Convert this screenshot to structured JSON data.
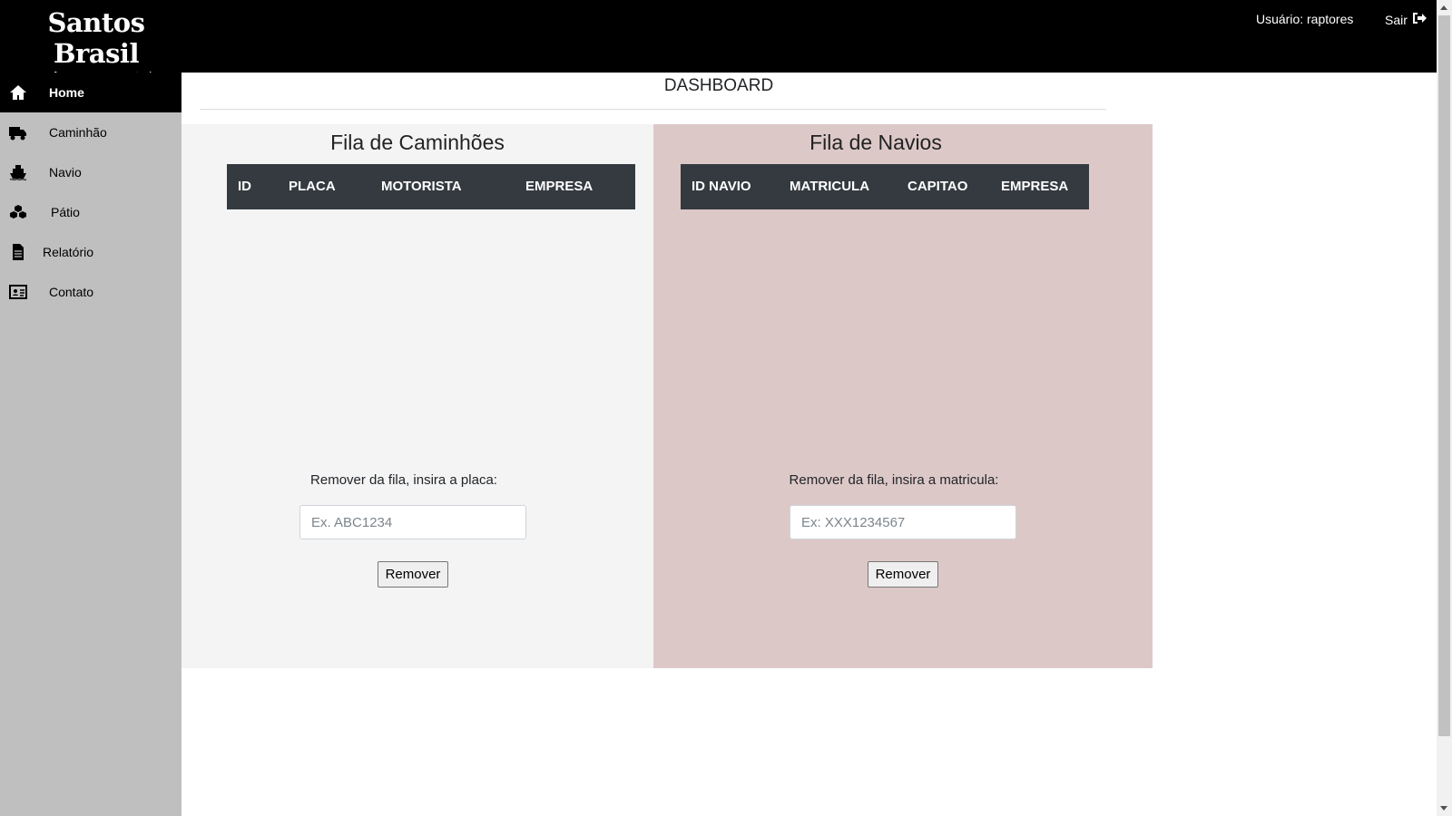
{
  "header": {
    "logo_title": "Santos Brasil",
    "logo_subtitle": "você sempre conectado",
    "user_label": "Usuário: raptores",
    "logout_label": "Sair",
    "logout_icon": "sign-out-icon"
  },
  "sidebar": {
    "items": [
      {
        "label": "Home",
        "icon": "home-icon",
        "active": true
      },
      {
        "label": "Caminhão",
        "icon": "truck-icon",
        "active": false
      },
      {
        "label": "Navio",
        "icon": "ship-icon",
        "active": false
      },
      {
        "label": "Pátio",
        "icon": "cubes-icon",
        "active": false
      },
      {
        "label": "Relatório",
        "icon": "file-icon",
        "active": false
      },
      {
        "label": "Contato",
        "icon": "id-card-icon",
        "active": false
      }
    ]
  },
  "main": {
    "title": "DASHBOARD",
    "trucks": {
      "title": "Fila de Caminhões",
      "columns": [
        "ID",
        "PLACA",
        "MOTORISTA",
        "EMPRESA"
      ],
      "rows": [],
      "remove_label": "Remover da fila, insira a placa:",
      "placeholder": "Ex. ABC1234",
      "button_label": "Remover"
    },
    "ships": {
      "title": "Fila de Navios",
      "columns": [
        "ID NAVIO",
        "MATRICULA",
        "CAPITAO",
        "EMPRESA"
      ],
      "rows": [],
      "remove_label": "Remover da fila, insira a matricula:",
      "placeholder": "Ex: XXX1234567",
      "button_label": "Remover"
    }
  },
  "colors": {
    "topbar": "#000000",
    "sidebar": "#bfbfbf",
    "table_header": "#343a40",
    "trucks_panel": "#f4f4f4",
    "ships_panel": "#ddc8c8"
  }
}
